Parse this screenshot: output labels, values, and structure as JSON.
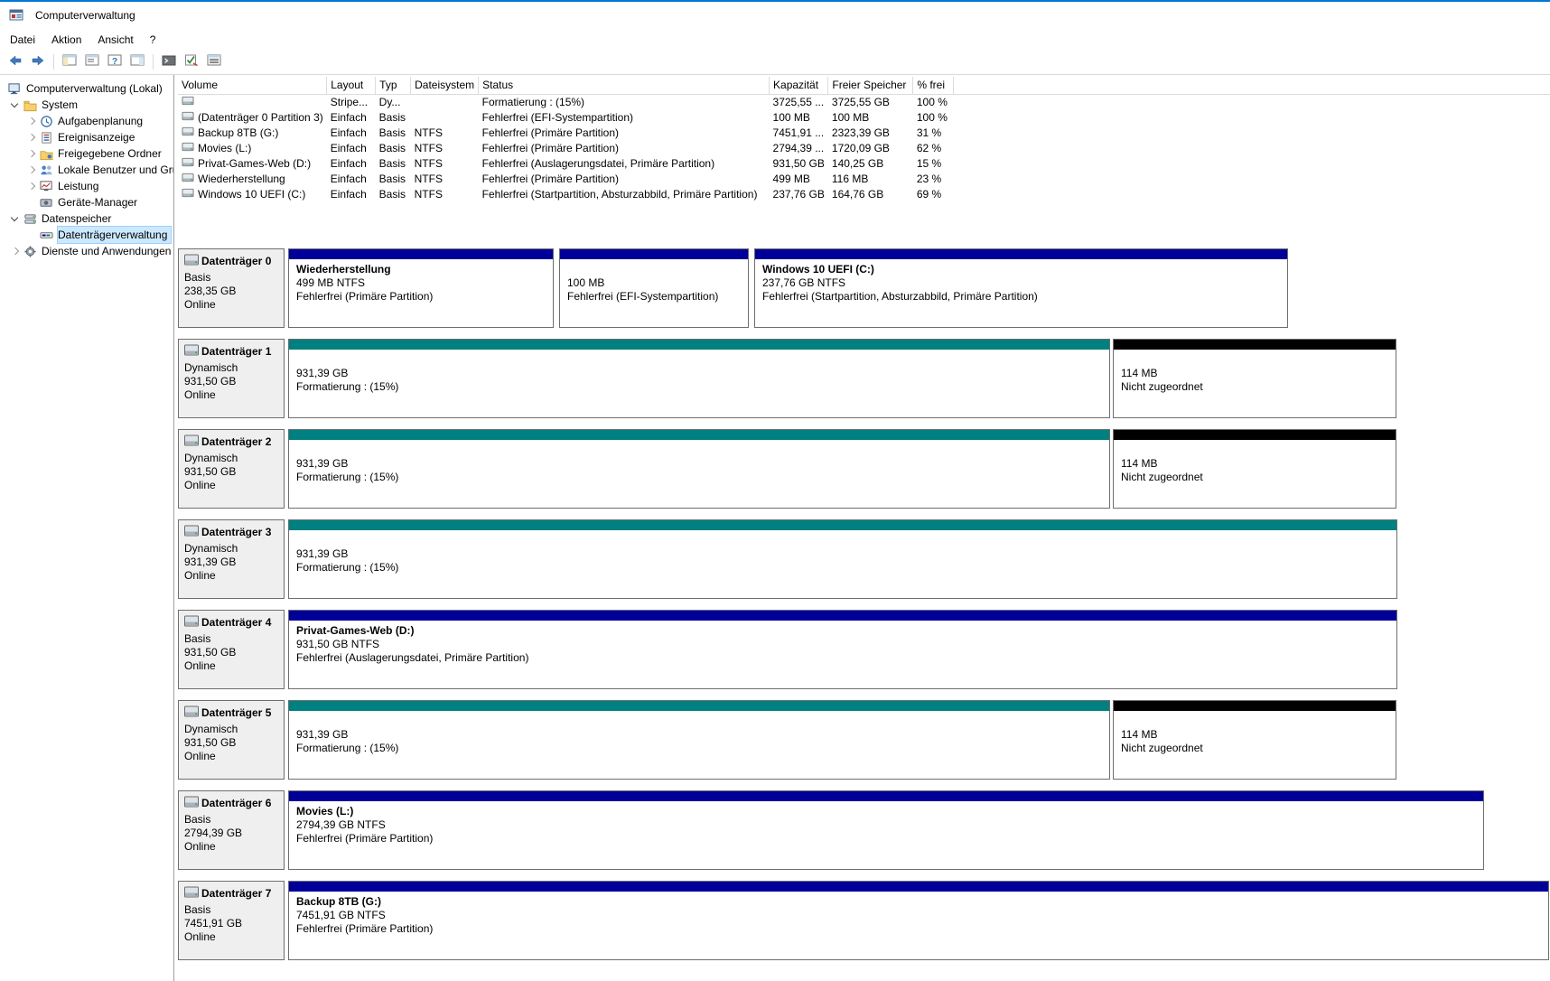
{
  "colors": {
    "accent": "#0078d7",
    "partition_primary_band": "#000099",
    "partition_dynamic_band": "#008080",
    "unallocated_band": "#000000",
    "selection_bg": "#cce8ff",
    "selection_border": "#99d1ff"
  },
  "window": {
    "title": "Computerverwaltung"
  },
  "menubar": {
    "items": [
      "Datei",
      "Aktion",
      "Ansicht",
      "?"
    ]
  },
  "toolbar": {
    "icons": [
      "back-icon",
      "forward-icon",
      "console-tree-icon",
      "properties-icon",
      "help-icon",
      "action-pane-icon",
      "up-level-icon",
      "check-disk-icon",
      "list-view-icon"
    ]
  },
  "sidebar": {
    "items": [
      {
        "label": "Computerverwaltung (Lokal)"
      },
      {
        "label": "System"
      },
      {
        "label": "Aufgabenplanung"
      },
      {
        "label": "Ereignisanzeige"
      },
      {
        "label": "Freigegebene Ordner"
      },
      {
        "label": "Lokale Benutzer und Gruppen"
      },
      {
        "label": "Leistung"
      },
      {
        "label": "Geräte-Manager"
      },
      {
        "label": "Datenspeicher"
      },
      {
        "label": "Datenträgerverwaltung"
      },
      {
        "label": "Dienste und Anwendungen"
      }
    ]
  },
  "volume_table": {
    "columns": [
      "Volume",
      "Layout",
      "Typ",
      "Dateisystem",
      "Status",
      "Kapazität",
      "Freier Speicher",
      "% frei"
    ],
    "rows": [
      {
        "volume": "",
        "layout": "Stripe...",
        "typ": "Dy...",
        "dateisystem": "",
        "status": "Formatierung : (15%)",
        "kapazitaet": "3725,55 ...",
        "freier_speicher": "3725,55 GB",
        "prozent_frei": "100 %"
      },
      {
        "volume": "(Datenträger 0 Partition 3)",
        "layout": "Einfach",
        "typ": "Basis",
        "dateisystem": "",
        "status": "Fehlerfrei (EFI-Systempartition)",
        "kapazitaet": "100 MB",
        "freier_speicher": "100 MB",
        "prozent_frei": "100 %"
      },
      {
        "volume": "Backup 8TB (G:)",
        "layout": "Einfach",
        "typ": "Basis",
        "dateisystem": "NTFS",
        "status": "Fehlerfrei (Primäre Partition)",
        "kapazitaet": "7451,91 ...",
        "freier_speicher": "2323,39 GB",
        "prozent_frei": "31 %"
      },
      {
        "volume": "Movies (L:)",
        "layout": "Einfach",
        "typ": "Basis",
        "dateisystem": "NTFS",
        "status": "Fehlerfrei (Primäre Partition)",
        "kapazitaet": "2794,39 ...",
        "freier_speicher": "1720,09 GB",
        "prozent_frei": "62 %"
      },
      {
        "volume": "Privat-Games-Web (D:)",
        "layout": "Einfach",
        "typ": "Basis",
        "dateisystem": "NTFS",
        "status": "Fehlerfrei (Auslagerungsdatei, Primäre Partition)",
        "kapazitaet": "931,50 GB",
        "freier_speicher": "140,25 GB",
        "prozent_frei": "15 %"
      },
      {
        "volume": "Wiederherstellung",
        "layout": "Einfach",
        "typ": "Basis",
        "dateisystem": "NTFS",
        "status": "Fehlerfrei (Primäre Partition)",
        "kapazitaet": "499 MB",
        "freier_speicher": "116 MB",
        "prozent_frei": "23 %"
      },
      {
        "volume": "Windows 10 UEFI (C:)",
        "layout": "Einfach",
        "typ": "Basis",
        "dateisystem": "NTFS",
        "status": "Fehlerfrei (Startpartition, Absturzabbild, Primäre Partition)",
        "kapazitaet": "237,76 GB",
        "freier_speicher": "164,76 GB",
        "prozent_frei": "69 %"
      }
    ]
  },
  "disks": [
    {
      "label": "Datenträger 0",
      "type": "Basis",
      "size": "238,35 GB",
      "status": "Online",
      "partitions": [
        {
          "name": "Wiederherstellung",
          "size": "499 MB NTFS",
          "status": "Fehlerfrei (Primäre Partition)",
          "color": "#000099"
        },
        {
          "name": "",
          "size": "100 MB",
          "status": "Fehlerfrei (EFI-Systempartition)",
          "color": "#000099"
        },
        {
          "name": "Windows 10 UEFI (C:)",
          "size": "237,76 GB NTFS",
          "status": "Fehlerfrei (Startpartition, Absturzabbild, Primäre Partition)",
          "color": "#000099"
        }
      ]
    },
    {
      "label": "Datenträger 1",
      "type": "Dynamisch",
      "size": "931,50 GB",
      "status": "Online",
      "partitions": [
        {
          "name": "",
          "size": "931,39 GB",
          "status": "Formatierung : (15%)",
          "color": "#008080"
        },
        {
          "name": "",
          "size": "114 MB",
          "status": "Nicht zugeordnet",
          "color": "#000000"
        }
      ]
    },
    {
      "label": "Datenträger 2",
      "type": "Dynamisch",
      "size": "931,50 GB",
      "status": "Online",
      "partitions": [
        {
          "name": "",
          "size": "931,39 GB",
          "status": "Formatierung : (15%)",
          "color": "#008080"
        },
        {
          "name": "",
          "size": "114 MB",
          "status": "Nicht zugeordnet",
          "color": "#000000"
        }
      ]
    },
    {
      "label": "Datenträger 3",
      "type": "Dynamisch",
      "size": "931,39 GB",
      "status": "Online",
      "partitions": [
        {
          "name": "",
          "size": "931,39 GB",
          "status": "Formatierung : (15%)",
          "color": "#008080"
        }
      ]
    },
    {
      "label": "Datenträger 4",
      "type": "Basis",
      "size": "931,50 GB",
      "status": "Online",
      "partitions": [
        {
          "name": "Privat-Games-Web (D:)",
          "size": "931,50 GB NTFS",
          "status": "Fehlerfrei (Auslagerungsdatei, Primäre Partition)",
          "color": "#000099"
        }
      ]
    },
    {
      "label": "Datenträger 5",
      "type": "Dynamisch",
      "size": "931,50 GB",
      "status": "Online",
      "partitions": [
        {
          "name": "",
          "size": "931,39 GB",
          "status": "Formatierung : (15%)",
          "color": "#008080"
        },
        {
          "name": "",
          "size": "114 MB",
          "status": "Nicht zugeordnet",
          "color": "#000000"
        }
      ]
    },
    {
      "label": "Datenträger 6",
      "type": "Basis",
      "size": "2794,39 GB",
      "status": "Online",
      "partitions": [
        {
          "name": "Movies (L:)",
          "size": "2794,39 GB NTFS",
          "status": "Fehlerfrei (Primäre Partition)",
          "color": "#000099"
        }
      ]
    },
    {
      "label": "Datenträger 7",
      "type": "Basis",
      "size": "7451,91 GB",
      "status": "Online",
      "partitions": [
        {
          "name": "Backup 8TB (G:)",
          "size": "7451,91 GB NTFS",
          "status": "Fehlerfrei (Primäre Partition)",
          "color": "#000099"
        }
      ]
    }
  ]
}
